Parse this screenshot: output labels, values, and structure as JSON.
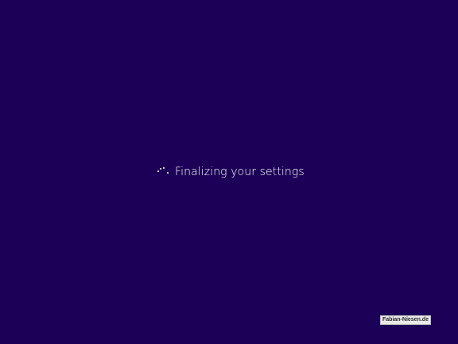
{
  "screen": {
    "background_color": "#1c0057",
    "status_text": "Finalizing your settings",
    "spinner_icon": "loading-dots-icon"
  },
  "watermark": {
    "text": "Fabian-Niesen.de"
  }
}
